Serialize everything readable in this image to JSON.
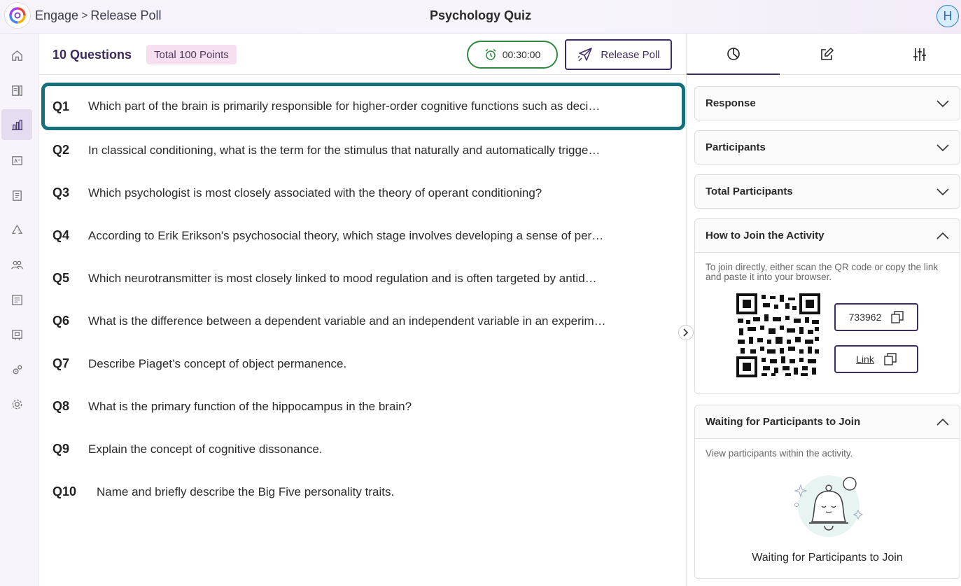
{
  "header": {
    "breadcrumb_app": "Engage",
    "breadcrumb_separator": ">",
    "breadcrumb_page": "Release Poll",
    "title": "Psychology Quiz",
    "avatar_initial": "H"
  },
  "sidebar": {
    "items": [
      {
        "name": "home-icon"
      },
      {
        "name": "library-icon"
      },
      {
        "name": "reports-icon",
        "active": true
      },
      {
        "name": "slides-icon"
      },
      {
        "name": "notebook-icon"
      },
      {
        "name": "recycle-icon"
      },
      {
        "name": "users-icon"
      },
      {
        "name": "list-icon"
      },
      {
        "name": "presentation-icon"
      },
      {
        "name": "integrations-icon"
      },
      {
        "name": "settings-icon"
      }
    ]
  },
  "main": {
    "question_count": "10 Questions",
    "total_points": "Total 100 Points",
    "timer": "00:30:00",
    "release_label": "Release Poll",
    "questions": [
      {
        "num": "Q1",
        "text": "Which part of the brain is primarily responsible for higher-order cognitive functions such as deci…"
      },
      {
        "num": "Q2",
        "text": "In classical conditioning, what is the term for the stimulus that naturally and automatically trigge…"
      },
      {
        "num": "Q3",
        "text": "Which psychologist is most closely associated with the theory of operant conditioning?"
      },
      {
        "num": "Q4",
        "text": "According to Erik Erikson's psychosocial theory, which stage involves developing a sense of per…"
      },
      {
        "num": "Q5",
        "text": "Which neurotransmitter is most closely linked to mood regulation and is often targeted by antid…"
      },
      {
        "num": "Q6",
        "text": "What is the difference between a dependent variable and an independent variable in an experim…"
      },
      {
        "num": "Q7",
        "text": "Describe Piaget’s concept of object permanence."
      },
      {
        "num": "Q8",
        "text": "What is the primary function of the hippocampus in the brain?"
      },
      {
        "num": "Q9",
        "text": "Explain the concept of cognitive dissonance."
      },
      {
        "num": "Q10",
        "text": "Name and briefly describe the Big Five personality traits."
      }
    ]
  },
  "right_panel": {
    "tabs": [
      "pie-chart-icon",
      "edit-icon",
      "sliders-icon"
    ],
    "response": "Response",
    "participants": "Participants",
    "total_participants": "Total Participants",
    "join": {
      "title": "How to Join the Activity",
      "instructions": "To join directly, either scan the QR code or copy the link and paste it into your browser.",
      "code": "733962",
      "link_label": "Link"
    },
    "waiting": {
      "title": "Waiting for Participants to Join",
      "subtitle": "View participants within the activity.",
      "caption": "Waiting for Participants to Join"
    }
  },
  "colors": {
    "accent": "#3d2b63",
    "selected_border": "#15707c",
    "timer_border": "#2e8a3f",
    "badge_bg": "#f7dff2"
  }
}
